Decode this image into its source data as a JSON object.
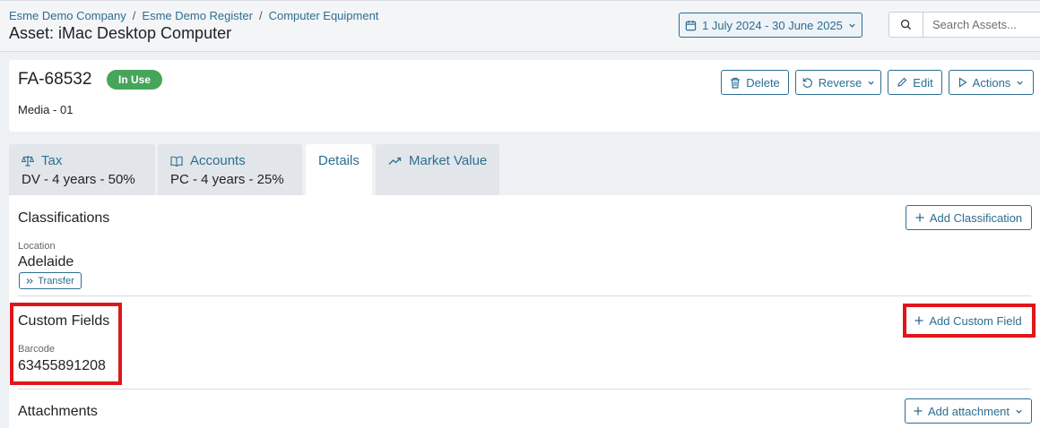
{
  "breadcrumb": [
    "Esme Demo Company",
    "Esme Demo Register",
    "Computer Equipment"
  ],
  "page_title": "Asset: iMac Desktop Computer",
  "date_range": "1 July 2024 - 30 June 2025",
  "search": {
    "placeholder": "Search Assets..."
  },
  "asset": {
    "id": "FA-68532",
    "status": "In Use",
    "subtitle": "Media - 01"
  },
  "actions": {
    "delete": "Delete",
    "reverse": "Reverse",
    "edit": "Edit",
    "actions": "Actions"
  },
  "tabs": [
    {
      "label": "Tax",
      "value": "DV - 4 years - 50%",
      "icon": "scale-icon"
    },
    {
      "label": "Accounts",
      "value": "PC - 4 years - 25%",
      "icon": "book-icon"
    },
    {
      "label": "Details",
      "value": ""
    },
    {
      "label": "Market Value",
      "value": "",
      "icon": "trend-up-icon"
    }
  ],
  "classifications": {
    "title": "Classifications",
    "add_label": "Add Classification",
    "field_label": "Location",
    "field_value": "Adelaide",
    "transfer_label": "Transfer"
  },
  "custom_fields": {
    "title": "Custom Fields",
    "add_label": "Add Custom Field",
    "field_label": "Barcode",
    "field_value": "63455891208"
  },
  "attachments": {
    "title": "Attachments",
    "add_label": "Add attachment"
  },
  "colors": {
    "accent": "#2c6e92",
    "status_green": "#47a55b",
    "highlight_red": "#e0161b"
  }
}
